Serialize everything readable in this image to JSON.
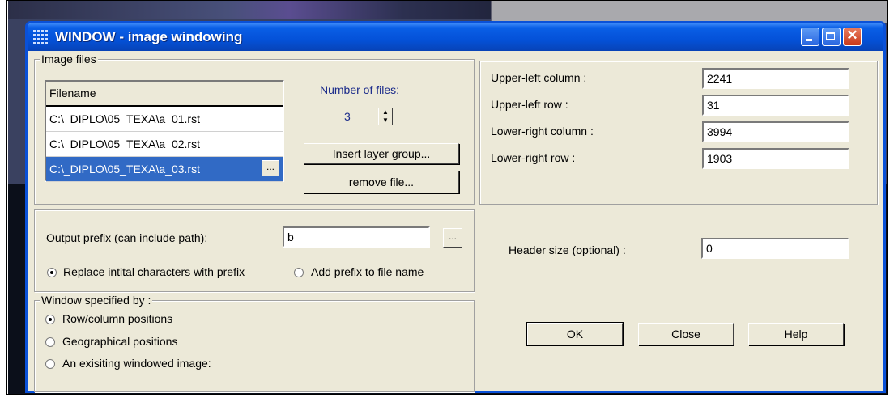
{
  "window": {
    "title": "WINDOW - image windowing"
  },
  "image_files": {
    "legend": "Image files",
    "column_header": "Filename",
    "rows": [
      "C:\\_DIPLO\\05_TEXA\\a_01.rst",
      "C:\\_DIPLO\\05_TEXA\\a_02.rst",
      "C:\\_DIPLO\\05_TEXA\\a_03.rst"
    ],
    "selected_index": 2,
    "browse_label": "...",
    "number_label": "Number of files:",
    "number_value": "3",
    "insert_label": "Insert layer group...",
    "remove_label": "remove file..."
  },
  "coords": {
    "upper_left_column_label": "Upper-left column :",
    "upper_left_column": "2241",
    "upper_left_row_label": "Upper-left row :",
    "upper_left_row": "31",
    "lower_right_column_label": "Lower-right column :",
    "lower_right_column": "3994",
    "lower_right_row_label": "Lower-right row :",
    "lower_right_row": "1903"
  },
  "output": {
    "prefix_label": "Output prefix (can include path):",
    "prefix_value": "b",
    "browse_label": "...",
    "replace_label": "Replace intital characters with prefix",
    "add_label": "Add prefix to file name",
    "selected": "replace"
  },
  "header": {
    "label": "Header size (optional) :",
    "value": "0"
  },
  "window_spec": {
    "legend": "Window specified by :",
    "options": [
      "Row/column positions",
      "Geographical positions",
      "An exisiting windowed image:"
    ],
    "selected_index": 0
  },
  "buttons": {
    "ok": "OK",
    "close": "Close",
    "help": "Help"
  }
}
